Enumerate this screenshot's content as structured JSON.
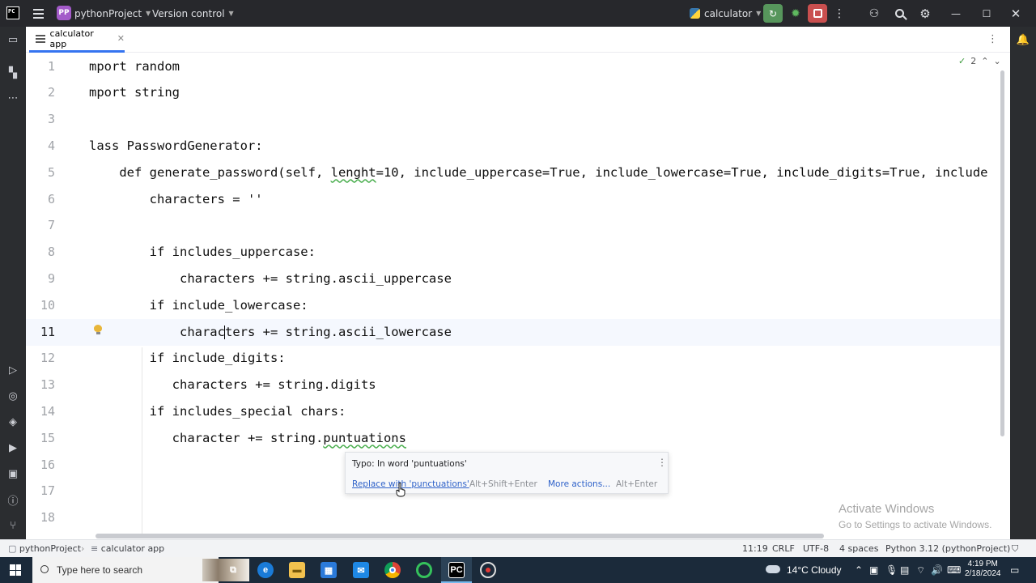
{
  "titlebar": {
    "project_badge": "PP",
    "project_name": "pythonProject",
    "version_control": "Version control",
    "run_config": "calculator"
  },
  "tab": {
    "label": "calculator app"
  },
  "editor": {
    "lines": [
      {
        "num": "1",
        "code": "mport random"
      },
      {
        "num": "2",
        "code": "mport string"
      },
      {
        "num": "3",
        "code": ""
      },
      {
        "num": "4",
        "code": "lass PasswordGenerator:"
      },
      {
        "num": "5",
        "code_pre": "    def generate_password(self, ",
        "code_typo": "lenght",
        "code_post": "=10, include_uppercase=True, include_lowercase=True, include_digits=True, include"
      },
      {
        "num": "6",
        "code": "        characters = ''"
      },
      {
        "num": "7",
        "code": ""
      },
      {
        "num": "8",
        "code": "        if includes_uppercase:"
      },
      {
        "num": "9",
        "code": "            characters += string.ascii_uppercase"
      },
      {
        "num": "10",
        "code": "        if include_lowercase:"
      },
      {
        "num": "11",
        "code_pre": "            charac",
        "code_post": "ters += string.ascii_lowercase"
      },
      {
        "num": "12",
        "code": "        if include_digits:"
      },
      {
        "num": "13",
        "code": "           characters += string.digits"
      },
      {
        "num": "14",
        "code": "        if includes_special chars:"
      },
      {
        "num": "15",
        "code_pre": "           character += string.",
        "code_typo": "puntuations",
        "code_post": ""
      },
      {
        "num": "16",
        "code": ""
      },
      {
        "num": "17",
        "code": ""
      },
      {
        "num": "18",
        "code": ""
      }
    ],
    "inspection_count": "2"
  },
  "popup": {
    "title": "Typo: In word 'puntuations'",
    "fix_label": "Replace with 'punctuations'",
    "fix_shortcut": "Alt+Shift+Enter",
    "more_label": "More actions...",
    "more_shortcut": "Alt+Enter"
  },
  "watermark": {
    "line1": "Activate Windows",
    "line2": "Go to Settings to activate Windows."
  },
  "statusbar": {
    "breadcrumb_project": "pythonProject",
    "breadcrumb_file": "calculator app",
    "position": "11:19",
    "line_sep": "CRLF",
    "encoding": "UTF-8",
    "indent": "4 spaces",
    "interpreter": "Python 3.12 (pythonProject)"
  },
  "taskbar": {
    "search_placeholder": "Type here to search",
    "weather": "14°C  Cloudy",
    "time": "4:19 PM",
    "date": "2/18/2024"
  },
  "colors": {
    "accent": "#3574f0",
    "run_green": "#57965c",
    "stop_red": "#c94f4f",
    "project_badge": "#a35bc9",
    "typo_underline": "#4caf50"
  }
}
